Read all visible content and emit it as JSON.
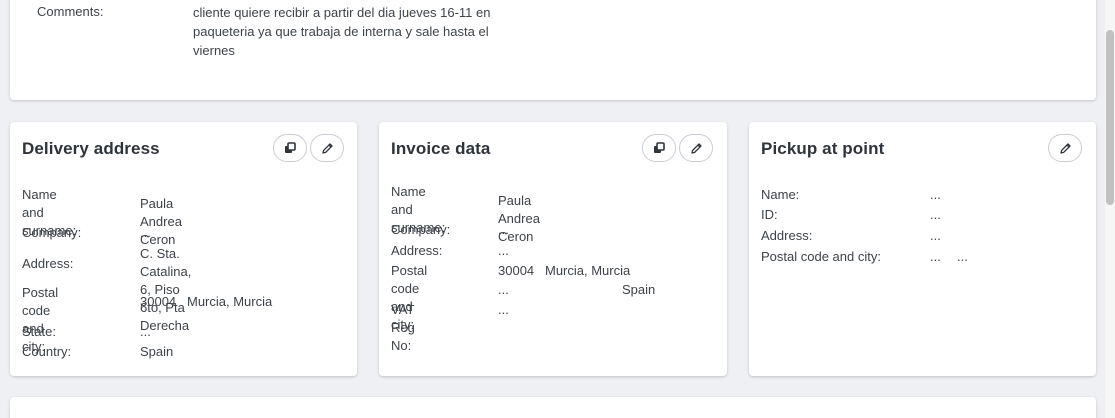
{
  "comments": {
    "label": "Comments:",
    "text_line1": "cliente quiere recibir a partir del dia jueves 16-11 en",
    "text_line2": "paqueteria ya que trabaja de interna y sale hasta el",
    "text_line3": "viernes"
  },
  "delivery": {
    "title": "Delivery address",
    "name_label_1": "Name and",
    "name_label_2": "surname:",
    "name_value": "Paula Andrea Ceron",
    "company_label": "Company:",
    "company_value": "...",
    "address_label": "Address:",
    "address_value_1": "C. Sta. Catalina, 6, Piso 6to, Pta",
    "address_value_2": "Derecha",
    "postal_label_1": "Postal code and",
    "postal_label_2": "city:",
    "postal_value": "30004   Murcia, Murcia",
    "state_label": "State:",
    "state_value": "...",
    "country_label": "Country:",
    "country_value": "Spain"
  },
  "invoice": {
    "title": "Invoice data",
    "name_label_1": "Name and",
    "name_label_2": "surname:",
    "name_value": "Paula Andrea Ceron",
    "company_label": "Company:",
    "company_value": "...",
    "address_label": "Address:",
    "address_value": "...",
    "postal_label_1": "Postal code",
    "postal_label_2": "and city:",
    "postal_value_1": "30004   Murcia, Murcia",
    "postal_value_2a": "...",
    "postal_value_2b": "Spain",
    "vat_label": "VAT Reg No:",
    "vat_value": "..."
  },
  "pickup": {
    "title": "Pickup at point",
    "name_label": "Name:",
    "name_value": "...",
    "id_label": "ID:",
    "id_value": "...",
    "address_label": "Address:",
    "address_value": "...",
    "postal_label": "Postal code and city:",
    "postal_value_a": "...",
    "postal_value_b": "..."
  },
  "icons": {
    "copy": "copy-icon",
    "edit": "pencil-icon"
  }
}
